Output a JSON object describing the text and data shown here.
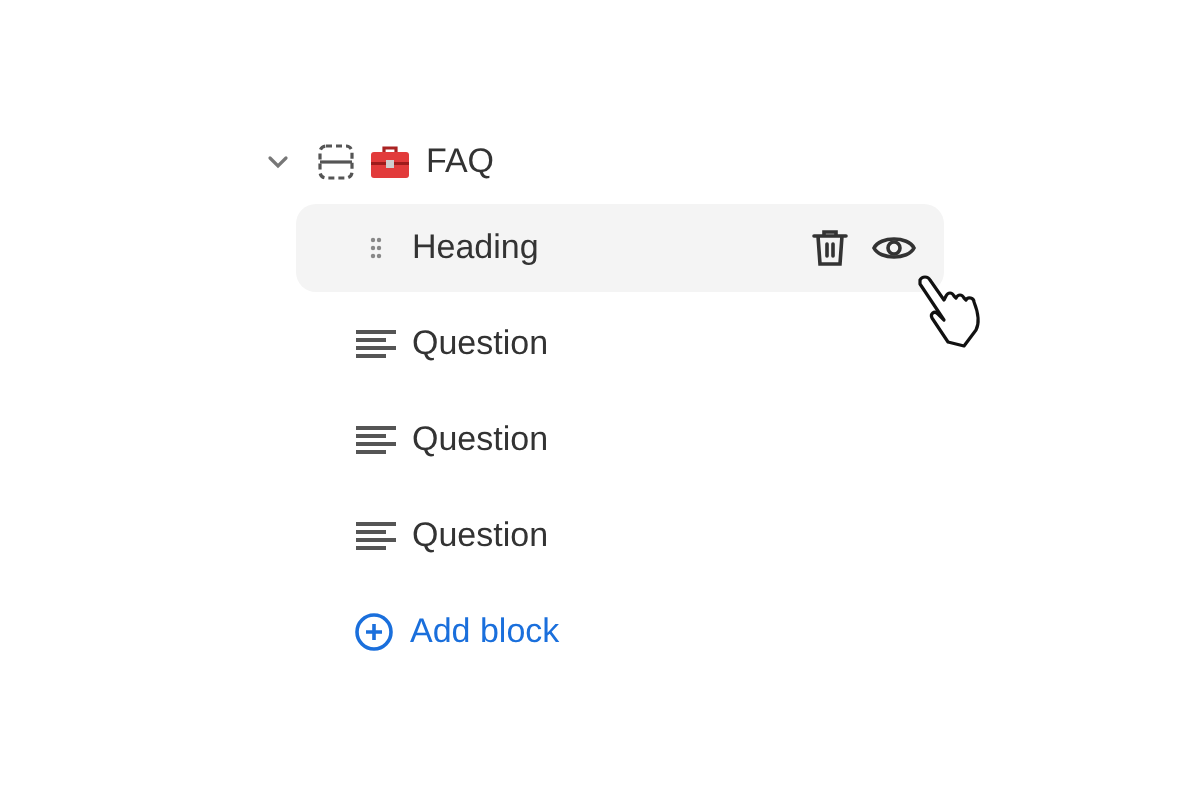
{
  "section": {
    "title": "FAQ",
    "expanded": true
  },
  "blocks": [
    {
      "kind": "heading",
      "label": "Heading",
      "hovered": true
    },
    {
      "kind": "text",
      "label": "Question",
      "hovered": false
    },
    {
      "kind": "text",
      "label": "Question",
      "hovered": false
    },
    {
      "kind": "text",
      "label": "Question",
      "hovered": false
    }
  ],
  "add_block": {
    "label": "Add block"
  }
}
